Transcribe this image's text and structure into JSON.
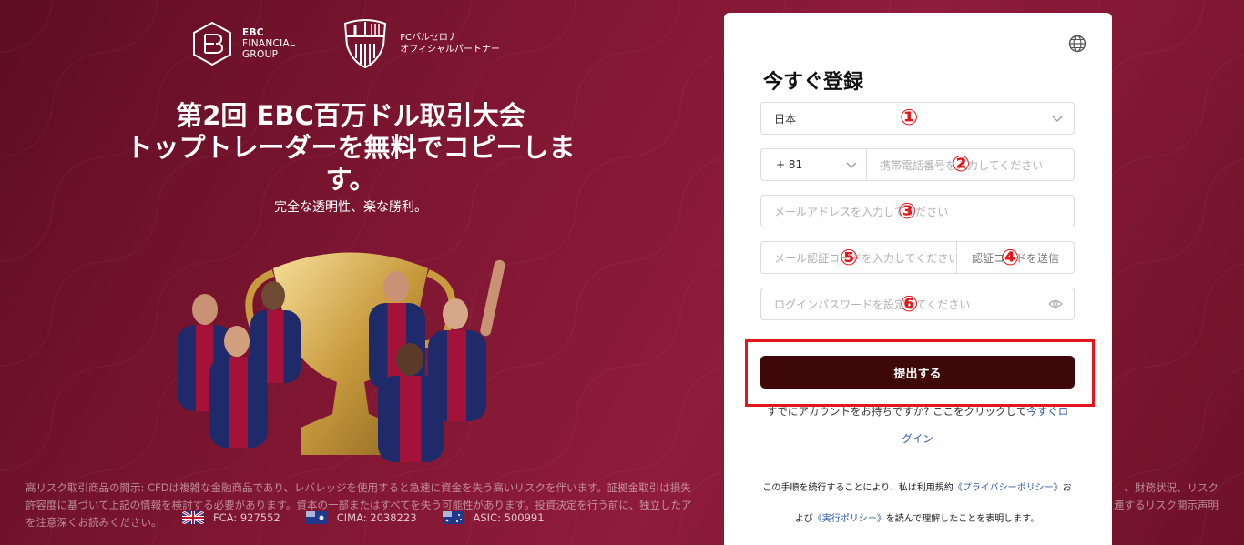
{
  "brand": {
    "ebc_line1": "EBC",
    "ebc_line2": "FINANCIAL",
    "ebc_line3": "GROUP",
    "fcb_line1": "FCバルセロナ",
    "fcb_line2": "オフィシャルパートナー"
  },
  "hero": {
    "title_line1": "第2回 EBC百万ドル取引大会",
    "title_line2": "トップトレーダーを無料でコピーしま",
    "title_line3": "す。",
    "subtitle": "完全な透明性、楽な勝利。"
  },
  "disclaimer": {
    "line1": "高リスク取引商品の開示: CFDは複雑な金融商品であり、レバレッジを使用すると急速に資金を失う高いリスクを伴います。証拠金取引は損失",
    "line2": "許容度に基づいて上記の情報を検討する必要があります。資本の一部またはすべてを失う可能性があります。投資決定を行う前に、独立したア",
    "line3": "を注意深くお読みください。",
    "right1": "、財務状況、リスク",
    "right2": "連するリスク開示声明"
  },
  "regulators": [
    {
      "label": "FCA: 927552"
    },
    {
      "label": "CIMA: 2038223"
    },
    {
      "label": "ASIC: 500991"
    }
  ],
  "form": {
    "title": "今すぐ登録",
    "country_value": "日本",
    "phone_prefix": "+ 81",
    "phone_placeholder": "携帯電話番号を入力してください",
    "email_placeholder": "メールアドレスを入力してください",
    "code_placeholder": "メール認証コードを入力してください",
    "send_code_label": "認証コードを送信",
    "password_placeholder": "ログインパスワードを設定してください",
    "submit_label": "提出する",
    "have_account": "すでにアカウントをお持ちですか? ここをクリックして",
    "login_link_part1": "今すぐロ",
    "login_link_part2": "グイン",
    "terms_part1": "この手順を続行することにより、私は利用規約",
    "privacy_link": "《プライバシーポリシー》",
    "terms_part2": "お",
    "terms_part3": "よび",
    "execution_link": "《実行ポリシー》",
    "terms_part4": "を読んで理解したことを表明します。"
  },
  "annotations": {
    "m1": "①",
    "m2": "②",
    "m3": "③",
    "m4": "④",
    "m5": "⑤",
    "m6": "⑥"
  },
  "colors": {
    "background": "#7f1632",
    "submit": "#3e0808",
    "annotation_red": "#e3161a",
    "link": "#2f5aa8"
  }
}
